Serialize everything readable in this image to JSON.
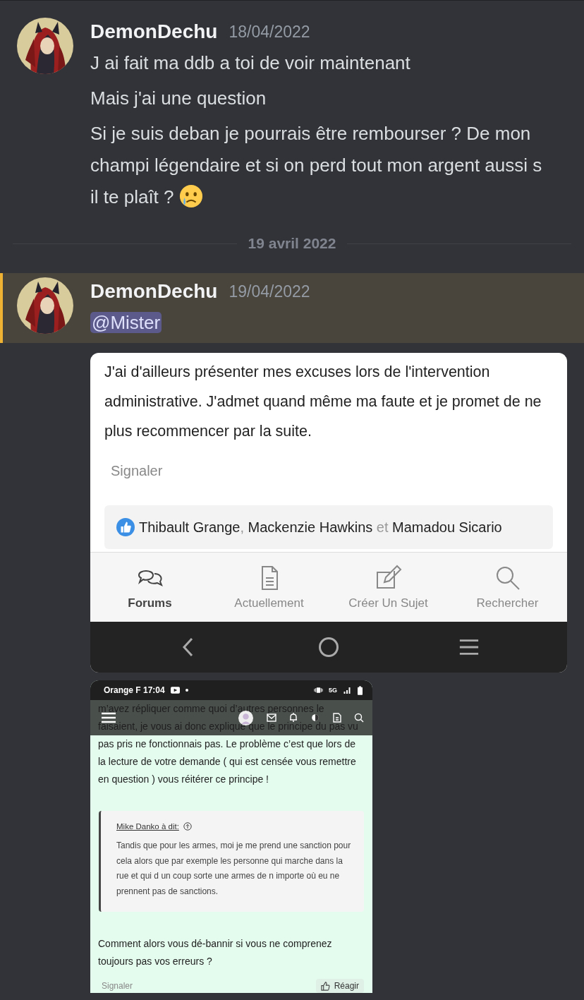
{
  "feed": [
    {
      "kind": "message",
      "author": "DemonDechu",
      "timestamp": "18/04/2022",
      "highlighted": false,
      "content": [
        {
          "kind": "text",
          "text": "J ai fait ma ddb a toi de voir maintenant"
        },
        {
          "kind": "text",
          "text": "Mais j'ai une question"
        },
        {
          "kind": "text_emoji",
          "text": "Si je suis deban je pourrais être rembourser ? De mon champi légendaire et si on perd tout mon argent aussi s il te plaît ?"
        }
      ]
    },
    {
      "kind": "divider",
      "label": "19 avril 2022"
    },
    {
      "kind": "message",
      "author": "DemonDechu",
      "timestamp": "19/04/2022",
      "highlighted": true,
      "content": [
        {
          "kind": "mention",
          "text": "@Mister"
        }
      ]
    }
  ],
  "attachments": [
    {
      "kind": "forum_post",
      "body": "J'ai d'ailleurs présenter mes excuses lors de l'intervention administrative. J'admet quand même ma faute et je promet de ne plus recommencer par la suite.",
      "report": "Signaler",
      "likes": [
        {
          "kind": "name",
          "text": "Thibault Grange"
        },
        {
          "kind": "sep",
          "text": ", "
        },
        {
          "kind": "name",
          "text": "Mackenzie Hawkins"
        },
        {
          "kind": "sep",
          "text": " et "
        },
        {
          "kind": "name",
          "text": "Mamadou Sicario"
        }
      ],
      "nav_tabs": [
        {
          "label": "Forums",
          "selected": true
        },
        {
          "label": "Actuellement",
          "selected": false
        },
        {
          "label": "Créer Un Sujet",
          "selected": false
        },
        {
          "label": "Rechercher",
          "selected": false
        }
      ]
    },
    {
      "kind": "forum_thread",
      "status_bar": {
        "carrier_time": "Orange F 17:04",
        "network": "5G"
      },
      "covered_lines": [
        "m’avez répliquer comme quoi d’autres personnes le",
        "faisaient, je vous ai donc expliqué que le principe du pas vu"
      ],
      "body": "pas pris ne fonctionnais pas. Le problème c’est que lors de la lecture de votre demande ( qui est censée vous remettre en question ) vous réitérer ce principe !",
      "quote": {
        "author": "Mike Danko à dit:",
        "text": "Tandis que pour les armes, moi je me prend une sanction pour cela alors que par exemple les personne qui marche dans la rue et qui d un coup sorte une armes de n importe où eu ne prennent pas de sanctions."
      },
      "reply": "Comment alors vous dé-bannir si vous ne comprenez toujours pas vos erreurs ?",
      "report": "Signaler",
      "react": "Réagir"
    }
  ]
}
